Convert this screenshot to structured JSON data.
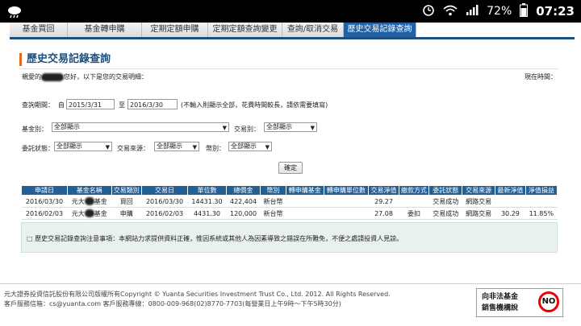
{
  "statusbar": {
    "battery": "72%",
    "time": "07:23"
  },
  "tabs": [
    "基金買回",
    "基金轉申購",
    "定期定額申購",
    "定期定額查詢變更",
    "查詢/取消交易",
    "歷史交易記錄查詢"
  ],
  "page_title": "歷史交易記錄查詢",
  "greeting": {
    "prefix": "親愛的",
    "suffix": "您好，以下是您的交易明細："
  },
  "now_label": "現在時間：",
  "query": {
    "period_label": "查詢期間：",
    "from_label": "自",
    "from": "2015/3/31",
    "to_label": "至",
    "to": "2016/3/30",
    "note": "(不輸入則顯示全部，花費時間較長，請依需要填寫)"
  },
  "filters": {
    "fund_label": "基金別：",
    "fund_value": "全部顯示",
    "trade_label": "交易別：",
    "trade_value": "全部顯示",
    "status_label": "委託狀態：",
    "status_value": "全部顯示",
    "source_label": "交易來源：",
    "source_value": "全部顯示",
    "currency_label": "幣別：",
    "currency_value": "全部顯示"
  },
  "confirm_label": "確定",
  "table": {
    "headers": [
      "申請日",
      "基金名稱",
      "交易類別",
      "交易日",
      "單位數",
      "總價金",
      "幣別",
      "轉申購基金",
      "轉申購單位數",
      "交易淨值",
      "繳款方式",
      "委託狀態",
      "交易來源",
      "最新淨值",
      "淨值損益"
    ],
    "rows": [
      [
        "2016/03/30",
        "元大",
        "基金",
        "買回",
        "2016/03/30",
        "14431.30",
        "422,404",
        "新台幣",
        "",
        "",
        "29.27",
        "",
        "交易成功",
        "網路交易",
        "",
        ""
      ],
      [
        "2016/02/03",
        "元大",
        "基金",
        "申購",
        "2016/02/03",
        "4431.30",
        "120,000",
        "新台幣",
        "",
        "",
        "27.08",
        "委扣",
        "交易成功",
        "網路交易",
        "30.29",
        "11.85%"
      ]
    ]
  },
  "notice": {
    "bullet": "□",
    "text": "歷史交易記錄查詢注意事項：本網站力求提供資料正確，惟因系統或其他人為因素導致之錯誤在所難免，不便之處請投資人見諒。"
  },
  "footer": {
    "line1": "元大證券投資信託股份有限公司版權所有Copyright © Yuanta Securities Investment Trust Co., Ltd. 2012. All Rights Reserved.",
    "line2": "客戶服務信箱：cs@yuanta.com 客戶服務專線：0800-009-968(02)8770-7703(每營業日上午9時～下午5時30分)"
  },
  "badge": {
    "line1": "向非法基金",
    "line2": "銷售機構說",
    "no": "NO"
  }
}
